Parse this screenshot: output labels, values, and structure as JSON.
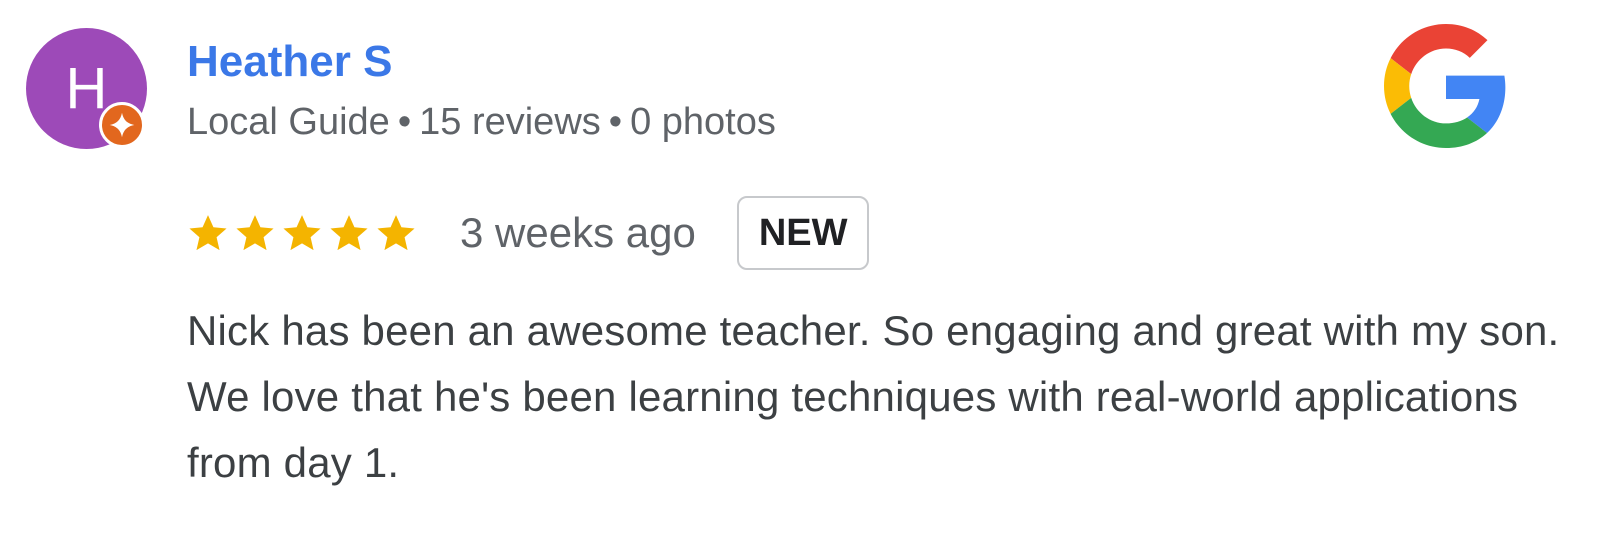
{
  "reviewer": {
    "initial": "H",
    "name": "Heather S",
    "level": "Local Guide",
    "separator": "•",
    "reviews": "15 reviews",
    "photos": "0 photos",
    "avatar_color": "#9d4ab8",
    "badge_color": "#e2671e",
    "badge_icon": "local-guide-star-icon"
  },
  "review": {
    "rating": 5,
    "max_rating": 5,
    "star_color": "#f4b400",
    "time": "3 weeks ago",
    "badge": "NEW",
    "text": "Nick has been an awesome teacher. So engaging and great with my son. We love that he's been learning techniques with real-world applications from day 1."
  },
  "source": {
    "icon": "google-logo-icon"
  },
  "colors": {
    "name_link": "#3b78e7",
    "text": "#3c4043",
    "meta": "#5f6368"
  }
}
